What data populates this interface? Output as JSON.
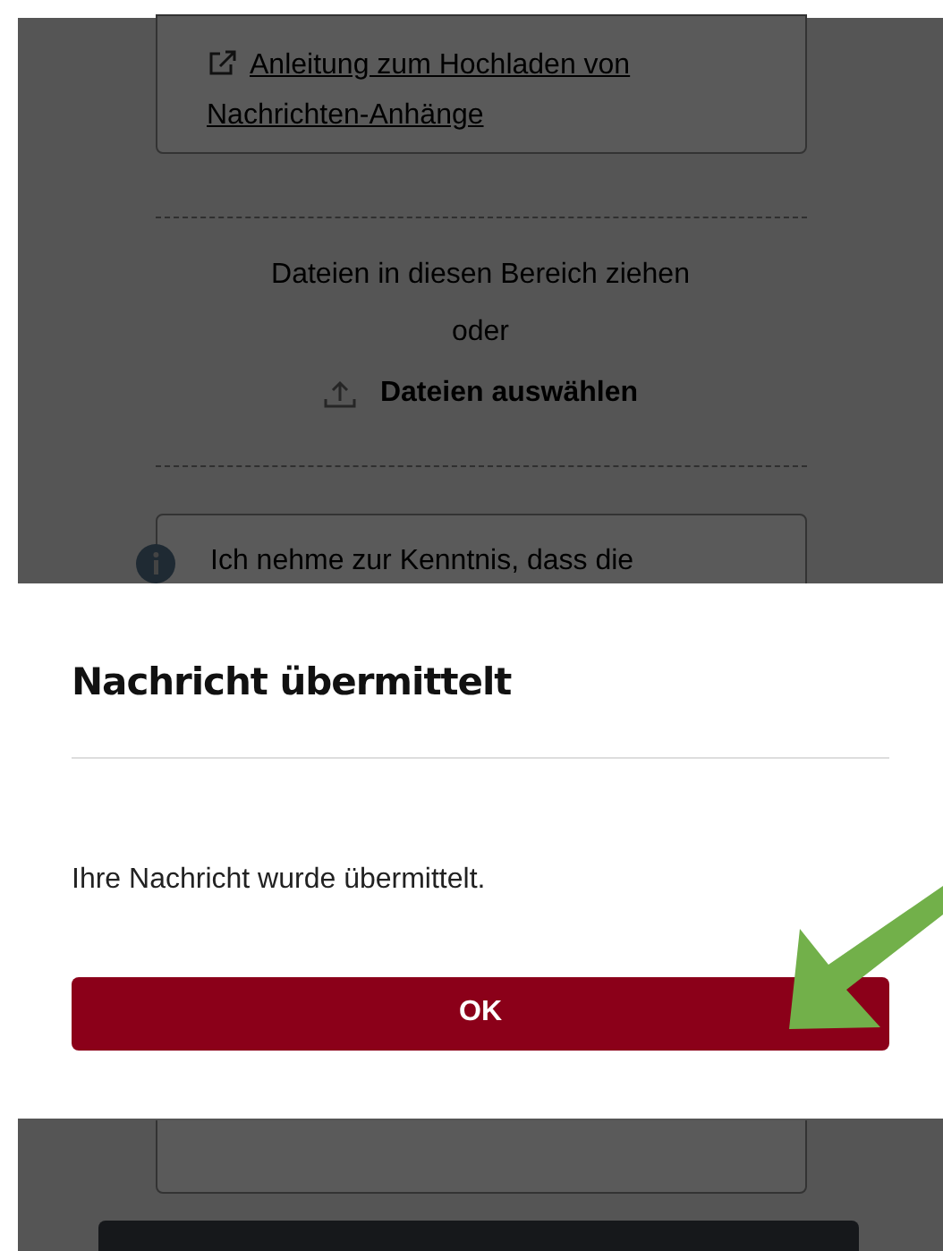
{
  "background": {
    "guide_link": "Anleitung zum Hochladen von Nachrichten-Anhänge",
    "dropzone": {
      "text": "Dateien in diesen Bereich ziehen",
      "separator": "oder",
      "choose_button": "Dateien auswählen"
    },
    "notice": "Ich nehme zur Kenntnis, dass die"
  },
  "dialog": {
    "title": "Nachricht übermittelt",
    "message": "Ihre Nachricht wurde übermittelt.",
    "button": "OK"
  }
}
